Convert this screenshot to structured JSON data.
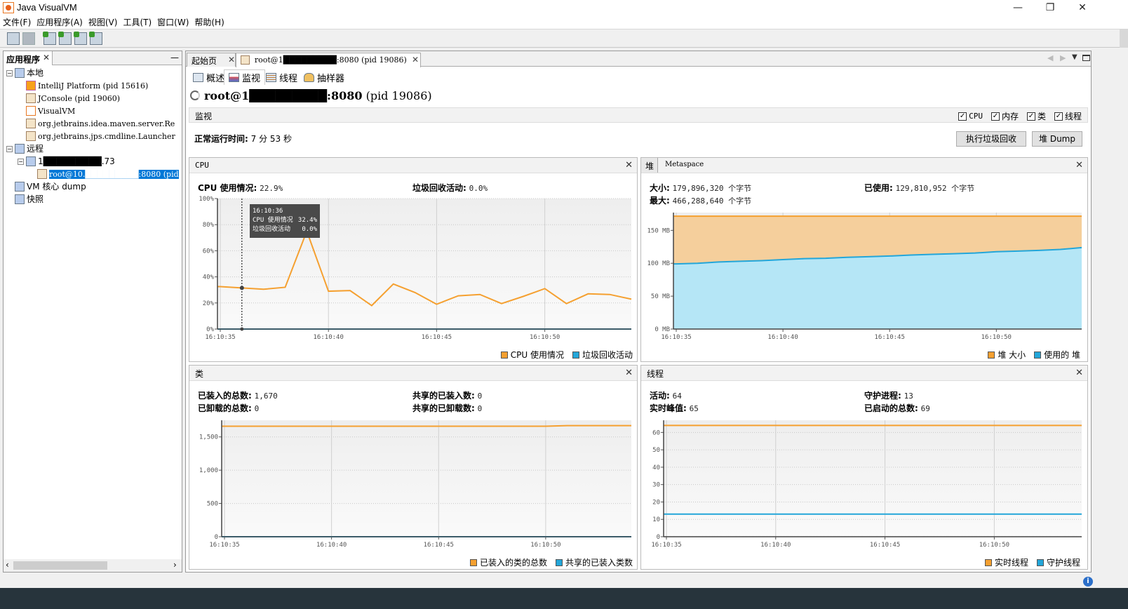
{
  "window": {
    "title": "Java VisualVM",
    "minimize": "—",
    "restore": "❐",
    "close": "✕"
  },
  "menu": [
    "文件(F)",
    "应用程序(A)",
    "视图(V)",
    "工具(T)",
    "窗口(W)",
    "帮助(H)"
  ],
  "toolbar": {
    "icons": [
      "open-icon",
      "save-icon",
      "add-remote-host-icon",
      "add-jmx-connection-icon",
      "load-dump-icon",
      "add-snapshot-icon"
    ]
  },
  "left_panel": {
    "tab_label": "应用程序",
    "close": "✕",
    "minimize": "—",
    "tree": [
      {
        "label": "本地",
        "level": 0,
        "icon": "computer-icon",
        "expander": "−"
      },
      {
        "label": "IntelliJ Platform (pid 15616)",
        "level": 1,
        "icon": "intellij-icon"
      },
      {
        "label": "JConsole (pid 19060)",
        "level": 1,
        "icon": "java-icon"
      },
      {
        "label": "VisualVM",
        "level": 1,
        "icon": "visualvm-icon"
      },
      {
        "label": "org.jetbrains.idea.maven.server.Re",
        "level": 1,
        "icon": "java-icon"
      },
      {
        "label": "org.jetbrains.jps.cmdline.Launcher",
        "level": 1,
        "icon": "java-icon"
      },
      {
        "label": "远程",
        "level": 0,
        "icon": "network-icon",
        "expander": "−"
      },
      {
        "label": "1█████████.73",
        "level": 1,
        "icon": "remote-host-icon",
        "expander": "−"
      },
      {
        "label": "root@10.█████████:8080 (pid",
        "level": 2,
        "icon": "jmx-icon",
        "selected": true
      },
      {
        "label": "VM 核心 dump",
        "level": 0,
        "icon": "core-dump-icon"
      },
      {
        "label": "快照",
        "level": 0,
        "icon": "snapshot-icon"
      }
    ]
  },
  "doc_tabs": [
    {
      "label": "起始页",
      "close": "✕"
    },
    {
      "label": "root@1█████████:8080 (pid 19086)",
      "close": "✕",
      "active": true
    }
  ],
  "sub_tabs": [
    {
      "label": "概述",
      "icon": "overview-icon"
    },
    {
      "label": "监视",
      "icon": "monitor-icon",
      "active": true
    },
    {
      "label": "线程",
      "icon": "threads-icon"
    },
    {
      "label": "抽样器",
      "icon": "sampler-icon"
    }
  ],
  "header": {
    "title": "root@1█████████:8080",
    "pid": "(pid 19086)"
  },
  "monitor": {
    "section_label": "监视",
    "checkboxes": [
      {
        "label": "CPU",
        "checked": true
      },
      {
        "label": "内存",
        "checked": true
      },
      {
        "label": "类",
        "checked": true
      },
      {
        "label": "线程",
        "checked": true
      }
    ],
    "uptime_label": "正常运行时间:",
    "uptime_value": "7 分 53 秒",
    "gc_button": "执行垃圾回收",
    "heap_dump_button": "堆 Dump"
  },
  "cpu_panel": {
    "title": "CPU",
    "stats": [
      {
        "label": "CPU 使用情况:",
        "value": "22.9%"
      },
      {
        "label": "垃圾回收活动:",
        "value": "0.0%"
      }
    ],
    "tooltip": {
      "time": "16:10:36",
      "rows": [
        [
          "CPU 使用情况",
          "32.4%"
        ],
        [
          "垃圾回收活动",
          "0.0%"
        ]
      ]
    },
    "legend": [
      {
        "label": "CPU 使用情况",
        "color": "#f5a030"
      },
      {
        "label": "垃圾回收活动",
        "color": "#23a6d9"
      }
    ]
  },
  "heap_panel": {
    "tabs": [
      "堆",
      "Metaspace"
    ],
    "stats": [
      {
        "label": "大小:",
        "value": "179,896,320 个字节"
      },
      {
        "label": "已使用:",
        "value": "129,810,952 个字节"
      },
      {
        "label": "最大:",
        "value": "466,288,640 个字节"
      }
    ],
    "legend": [
      {
        "label": "堆 大小",
        "color": "#f5a030"
      },
      {
        "label": "使用的 堆",
        "color": "#23a6d9"
      }
    ]
  },
  "classes_panel": {
    "title": "类",
    "stats": [
      {
        "label": "已装入的总数:",
        "value": "1,670"
      },
      {
        "label": "共享的已装入数:",
        "value": "0"
      },
      {
        "label": "已卸载的总数:",
        "value": "0"
      },
      {
        "label": "共享的已卸载数:",
        "value": "0"
      }
    ],
    "legend": [
      {
        "label": "已装入的类的总数",
        "color": "#f5a030"
      },
      {
        "label": "共享的已装入类数",
        "color": "#23a6d9"
      }
    ]
  },
  "threads_panel": {
    "title": "线程",
    "stats": [
      {
        "label": "活动:",
        "value": "64"
      },
      {
        "label": "守护进程:",
        "value": "13"
      },
      {
        "label": "实时峰值:",
        "value": "65"
      },
      {
        "label": "已启动的总数:",
        "value": "69"
      }
    ],
    "legend": [
      {
        "label": "实时线程",
        "color": "#f5a030"
      },
      {
        "label": "守护线程",
        "color": "#23a6d9"
      }
    ]
  },
  "chart_data": [
    {
      "id": "cpu",
      "type": "line",
      "title": "CPU",
      "x": [
        "16:10:35",
        "16:10:36",
        "16:10:37",
        "16:10:38",
        "16:10:39",
        "16:10:40",
        "16:10:41",
        "16:10:42",
        "16:10:43",
        "16:10:44",
        "16:10:45",
        "16:10:46",
        "16:10:47",
        "16:10:48",
        "16:10:49",
        "16:10:50",
        "16:10:51",
        "16:10:52",
        "16:10:53",
        "16:10:54"
      ],
      "x_ticks": [
        "16:10:35",
        "16:10:40",
        "16:10:45",
        "16:10:50"
      ],
      "y_ticks": [
        "0%",
        "20%",
        "40%",
        "60%",
        "80%",
        "100%"
      ],
      "ylim": [
        0,
        100
      ],
      "series": [
        {
          "name": "CPU 使用情况",
          "color": "#f5a030",
          "values": [
            32.5,
            31.5,
            30.5,
            32,
            75,
            29,
            29.5,
            18,
            34.5,
            28,
            19,
            25.5,
            26.5,
            19.5,
            25,
            31,
            19.5,
            27,
            26.5,
            22.9
          ]
        },
        {
          "name": "垃圾回收活动",
          "color": "#23a6d9",
          "values": [
            0,
            0,
            0,
            0,
            0,
            0,
            0,
            0,
            0,
            0,
            0,
            0,
            0,
            0,
            0,
            0,
            0,
            0,
            0,
            0
          ]
        }
      ],
      "grid": true,
      "legend": "bottom-right"
    },
    {
      "id": "heap",
      "type": "area",
      "title": "堆",
      "x": [
        "16:10:35",
        "16:10:36",
        "16:10:37",
        "16:10:38",
        "16:10:39",
        "16:10:40",
        "16:10:41",
        "16:10:42",
        "16:10:43",
        "16:10:44",
        "16:10:45",
        "16:10:46",
        "16:10:47",
        "16:10:48",
        "16:10:49",
        "16:10:50",
        "16:10:51",
        "16:10:52",
        "16:10:53",
        "16:10:54"
      ],
      "x_ticks": [
        "16:10:35",
        "16:10:40",
        "16:10:45",
        "16:10:50"
      ],
      "y_ticks": [
        "0 MB",
        "50 MB",
        "100 MB",
        "150 MB"
      ],
      "ylim": [
        0,
        177
      ],
      "series": [
        {
          "name": "堆 大小",
          "color": "#f5a030",
          "values": [
            171.6,
            171.6,
            171.6,
            171.6,
            171.6,
            171.6,
            171.6,
            171.6,
            171.6,
            171.6,
            171.6,
            171.6,
            171.6,
            171.6,
            171.6,
            171.6,
            171.6,
            171.6,
            171.6,
            171.6
          ]
        },
        {
          "name": "使用的 堆",
          "color": "#23a6d9",
          "values": [
            99,
            100,
            102,
            103,
            104,
            105.5,
            107,
            107.5,
            109,
            110,
            111,
            112.5,
            113.5,
            114.5,
            115.5,
            117.5,
            118.5,
            119.5,
            121,
            123.8
          ]
        }
      ],
      "grid": true,
      "legend": "bottom-right"
    },
    {
      "id": "classes",
      "type": "line",
      "title": "类",
      "x_ticks": [
        "16:10:35",
        "16:10:40",
        "16:10:45",
        "16:10:50"
      ],
      "y_ticks": [
        "0",
        "500",
        "1,000",
        "1,500"
      ],
      "ylim": [
        0,
        1750
      ],
      "series": [
        {
          "name": "已装入的类的总数",
          "color": "#f5a030",
          "values": [
            1660,
            1660,
            1660,
            1660,
            1660,
            1660,
            1660,
            1660,
            1660,
            1660,
            1660,
            1660,
            1660,
            1660,
            1660,
            1660,
            1670,
            1670,
            1670,
            1670
          ]
        },
        {
          "name": "共享的已装入类数",
          "color": "#23a6d9",
          "values": [
            0,
            0,
            0,
            0,
            0,
            0,
            0,
            0,
            0,
            0,
            0,
            0,
            0,
            0,
            0,
            0,
            0,
            0,
            0,
            0
          ]
        }
      ],
      "grid": true,
      "legend": "bottom-right"
    },
    {
      "id": "threads",
      "type": "line",
      "title": "线程",
      "x_ticks": [
        "16:10:35",
        "16:10:40",
        "16:10:45",
        "16:10:50"
      ],
      "y_ticks": [
        "0",
        "10",
        "20",
        "30",
        "40",
        "50",
        "60"
      ],
      "ylim": [
        0,
        67
      ],
      "series": [
        {
          "name": "实时线程",
          "color": "#f5a030",
          "values": [
            64,
            64,
            64,
            64,
            64,
            64,
            64,
            64,
            64,
            64,
            64,
            64,
            64,
            64,
            64,
            64,
            64,
            64,
            64,
            64
          ]
        },
        {
          "name": "守护线程",
          "color": "#23a6d9",
          "values": [
            13,
            13,
            13,
            13,
            13,
            13,
            13,
            13,
            13,
            13,
            13,
            13,
            13,
            13,
            13,
            13,
            13,
            13,
            13,
            13
          ]
        }
      ],
      "grid": true,
      "legend": "bottom-right"
    }
  ]
}
